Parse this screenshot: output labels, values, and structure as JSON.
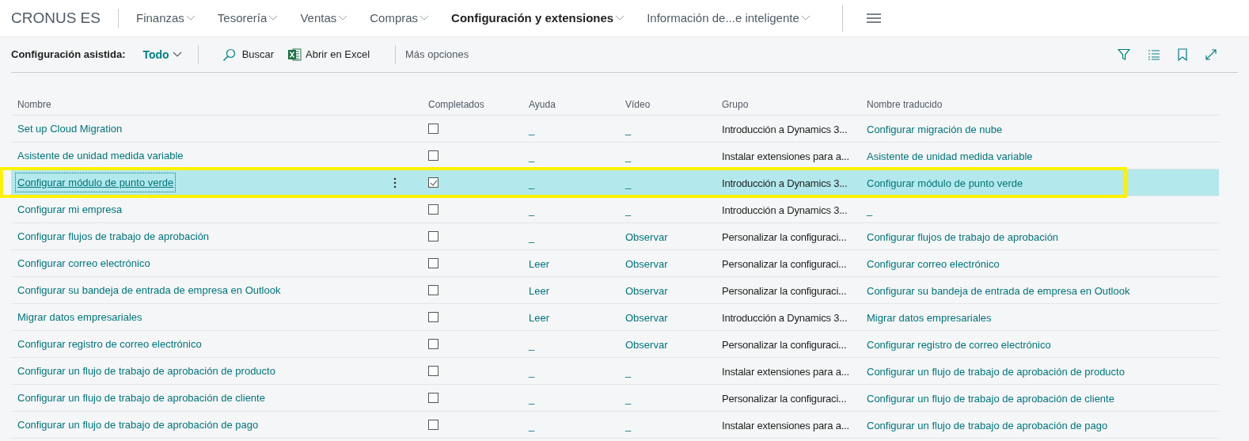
{
  "app": {
    "company": "CRONUS ES"
  },
  "nav": [
    {
      "label": "Finanzas",
      "selected": false
    },
    {
      "label": "Tesorería",
      "selected": false
    },
    {
      "label": "Ventas",
      "selected": false
    },
    {
      "label": "Compras",
      "selected": false
    },
    {
      "label": "Configuración y extensiones",
      "selected": true
    },
    {
      "label": "Información de...e inteligente",
      "selected": false
    }
  ],
  "toolbar": {
    "title": "Configuración asistida:",
    "filter": "Todo",
    "actions": [
      {
        "kind": "search",
        "label": "Buscar"
      },
      {
        "kind": "excel",
        "label": "Abrir en Excel"
      }
    ],
    "more": "Más opciones"
  },
  "table": {
    "columns": [
      "Nombre",
      "Completados",
      "Ayuda",
      "Vídeo",
      "Grupo",
      "Nombre traducido"
    ],
    "rows": [
      {
        "name": "Set up Cloud Migration",
        "completed": false,
        "help": "_",
        "video": "_",
        "group": "Introducción a Dynamics 3...",
        "translated": "Configurar migración de nube",
        "selected": false,
        "highlighted": false
      },
      {
        "name": "Asistente de unidad medida variable",
        "completed": false,
        "help": "_",
        "video": "_",
        "group": "Instalar extensiones para a...",
        "translated": "Asistente de unidad medida variable",
        "selected": false,
        "highlighted": false
      },
      {
        "name": "Configurar módulo de punto verde",
        "completed": true,
        "help": "_",
        "video": "_",
        "group": "Introducción a Dynamics 3...",
        "translated": "Configurar módulo de punto verde",
        "selected": true,
        "highlighted": true
      },
      {
        "name": "Configurar mi empresa",
        "completed": false,
        "help": "_",
        "video": "_",
        "group": "Introducción a Dynamics 3...",
        "translated": "_",
        "selected": false,
        "highlighted": false
      },
      {
        "name": "Configurar flujos de trabajo de aprobación",
        "completed": false,
        "help": "_",
        "video": "Observar",
        "group": "Personalizar la configuraci...",
        "translated": "Configurar flujos de trabajo de aprobación",
        "selected": false,
        "highlighted": false
      },
      {
        "name": "Configurar correo electrónico",
        "completed": false,
        "help": "Leer",
        "video": "Observar",
        "group": "Personalizar la configuraci...",
        "translated": "Configurar correo electrónico",
        "selected": false,
        "highlighted": false
      },
      {
        "name": "Configurar su bandeja de entrada de empresa en Outlook",
        "completed": false,
        "help": "Leer",
        "video": "Observar",
        "group": "Personalizar la configuraci...",
        "translated": "Configurar su bandeja de entrada de empresa en Outlook",
        "selected": false,
        "highlighted": false
      },
      {
        "name": "Migrar datos empresariales",
        "completed": false,
        "help": "Leer",
        "video": "Observar",
        "group": "Introducción a Dynamics 3...",
        "translated": "Migrar datos empresariales",
        "selected": false,
        "highlighted": false
      },
      {
        "name": "Configurar registro de correo electrónico",
        "completed": false,
        "help": "_",
        "video": "Observar",
        "group": "Personalizar la configuraci...",
        "translated": "Configurar registro de correo electrónico",
        "selected": false,
        "highlighted": false
      },
      {
        "name": "Configurar un flujo de trabajo de aprobación de producto",
        "completed": false,
        "help": "_",
        "video": "_",
        "group": "Instalar extensiones para a...",
        "translated": "Configurar un flujo de trabajo de aprobación de producto",
        "selected": false,
        "highlighted": false
      },
      {
        "name": "Configurar un flujo de trabajo de aprobación de cliente",
        "completed": false,
        "help": "_",
        "video": "_",
        "group": "Personalizar la configuraci...",
        "translated": "Configurar un flujo de trabajo de aprobación de cliente",
        "selected": false,
        "highlighted": false
      },
      {
        "name": "Configurar un flujo de trabajo de aprobación de pago",
        "completed": false,
        "help": "_",
        "video": "_",
        "group": "Instalar extensiones para a...",
        "translated": "Configurar un flujo de trabajo de aprobación de pago",
        "selected": false,
        "highlighted": false
      }
    ]
  }
}
